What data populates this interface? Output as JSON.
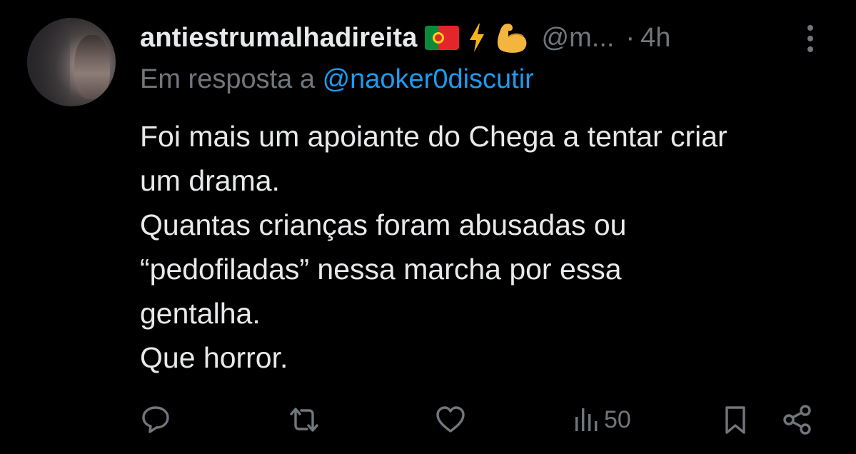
{
  "tweet": {
    "display_name": "antiestrumalhadireita",
    "handle": "@m...",
    "separator": "·",
    "time": "4h",
    "reply_prefix": "Em resposta a",
    "reply_to": "@naoker0discutir",
    "body_lines": [
      "Foi mais um apoiante do Chega a tentar criar",
      "um drama.",
      "Quantas crianças foram abusadas ou",
      "“pedofiladas” nessa marcha por essa",
      "gentalha.",
      "Que horror."
    ],
    "name_emojis": [
      "portugal-flag-icon",
      "lightning-icon",
      "flexed-biceps-icon"
    ],
    "actions": {
      "views_count": "50"
    }
  },
  "icons": {
    "reply": "speech-bubble-icon",
    "retweet": "retweet-icon",
    "like": "heart-icon",
    "views": "bar-chart-icon",
    "bookmark": "bookmark-icon",
    "share": "share-icon",
    "more": "vertical-dots-icon"
  },
  "colors": {
    "background": "#000000",
    "text": "#e7e9ea",
    "secondary": "#71767b",
    "link": "#1d9bf0"
  }
}
